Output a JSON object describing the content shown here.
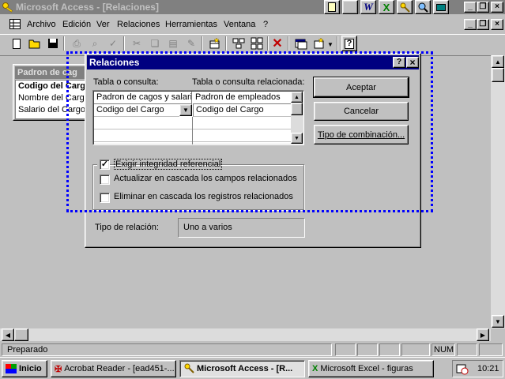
{
  "app": {
    "title": "Microsoft Access - [Relaciones]",
    "tray_icons": [
      "word-icon",
      "excel-icon",
      "key-icon",
      "search-icon",
      "screen-icon"
    ]
  },
  "menu": {
    "items": [
      "Archivo",
      "Edición",
      "Ver",
      "Relaciones",
      "Herramientas",
      "Ventana",
      "?"
    ]
  },
  "table_box": {
    "title": "Padron de cag",
    "fields": [
      "Codigo del Cargo",
      "Nombre del Cargo",
      "Salario del Cargo"
    ]
  },
  "dialog": {
    "title": "Relaciones",
    "help_glyph": "?",
    "close_glyph": "×",
    "table_label": "Tabla o consulta:",
    "related_label": "Tabla o consulta relacionada:",
    "grid": {
      "table_header": "Padron de cagos y salario",
      "related_header": "Padron de empleados",
      "table_field": "Codigo del Cargo",
      "related_field": "Codigo del Cargo"
    },
    "buttons": {
      "accept": "Aceptar",
      "cancel": "Cancelar",
      "join_type": "Tipo de combinación..."
    },
    "enforce": {
      "label": "Exigir integridad referencial",
      "checked": true
    },
    "cascade_update": {
      "label": "Actualizar en cascada los campos relacionados",
      "checked": false
    },
    "cascade_delete": {
      "label": "Eliminar en cascada los registros relacionados",
      "checked": false
    },
    "relation_type_label": "Tipo de relación:",
    "relation_type_value": "Uno a varios"
  },
  "status": {
    "text": "Preparado",
    "num": "NUM"
  },
  "taskbar": {
    "start": "Inicio",
    "tasks": [
      "Acrobat Reader - [ead451-...",
      "Microsoft Access - [R...",
      "Microsoft Excel - figuras"
    ],
    "clock": "10:21"
  },
  "colors": {
    "active_title": "#000080",
    "inactive_title": "#808080",
    "selection_dots": "#0000ff",
    "face": "#c0c0c0"
  }
}
